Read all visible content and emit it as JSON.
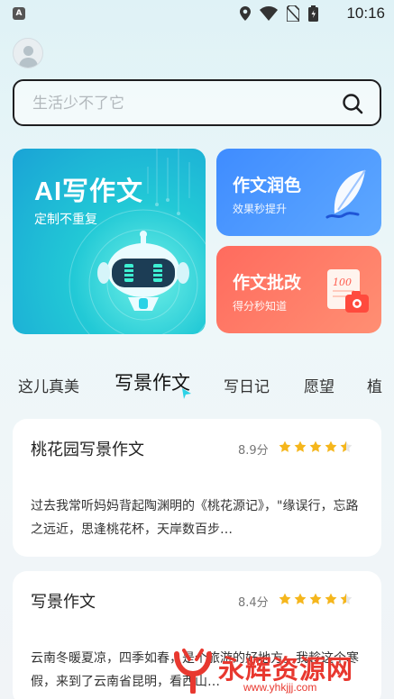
{
  "status_bar": {
    "time": "10:16",
    "app_badge": "A",
    "icons": [
      "location-icon",
      "wifi-icon",
      "no-sim-icon",
      "battery-icon"
    ]
  },
  "search": {
    "placeholder": "生活少不了它"
  },
  "features": {
    "ai_write": {
      "title": "AI写作文",
      "subtitle": "定制不重复"
    },
    "polish": {
      "title": "作文润色",
      "subtitle": "效果秒提升"
    },
    "grade": {
      "title": "作文批改",
      "subtitle": "得分秒知道",
      "badge": "100"
    }
  },
  "tabs": [
    "这儿真美",
    "写景作文",
    "写日记",
    "愿望",
    "植"
  ],
  "active_tab": "写景作文",
  "articles": [
    {
      "title": "桃花园写景作文",
      "score": "8.9分",
      "rating": 4.5,
      "excerpt": "过去我常听妈妈背起陶渊明的《桃花源记》，\"缘误行，忘路之远近，思逢桃花杯，天岸数百步…"
    },
    {
      "title": "写景作文",
      "score": "8.4分",
      "rating": 4.5,
      "excerpt": "云南冬暖夏凉，四季如春，是个旅游的好地方。我趁这个寒假，来到了云南省昆明，看西山…"
    }
  ],
  "watermark": {
    "text": "永辉资源网",
    "url": "www.yhkjjj.com"
  },
  "colors": {
    "ai_card": "#22c9d6",
    "polish_card": "#3f8cff",
    "grade_card": "#ff6b5e",
    "star": "#f5b61c",
    "watermark": "#e8382f"
  }
}
